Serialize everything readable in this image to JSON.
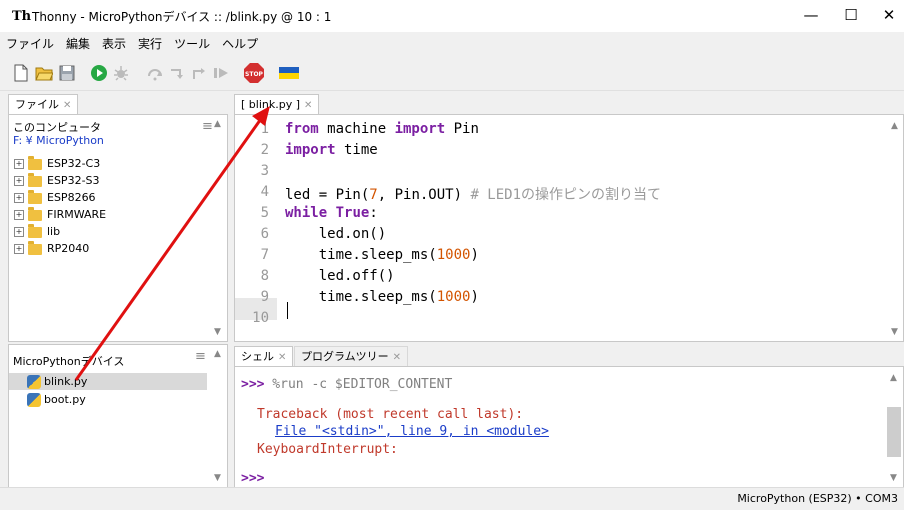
{
  "window": {
    "logo": "Th",
    "title": "Thonny  -  MicroPythonデバイス :: /blink.py  @  10 : 1",
    "minimize": "—",
    "maximize": "☐",
    "close": "✕"
  },
  "menu": [
    "ファイル",
    "編集",
    "表示",
    "実行",
    "ツール",
    "ヘルプ"
  ],
  "toolbar": [
    "new-file",
    "open-file",
    "save-file",
    "run",
    "debug",
    "step-over",
    "step-into",
    "step-out",
    "resume",
    "stop",
    "ukraine-flag"
  ],
  "stop_label": "STOP",
  "files_panel": {
    "tab_label": "ファイル",
    "computer": {
      "title": "このコンピュータ",
      "path": "F: ¥ MicroPython",
      "folders": [
        "ESP32-C3",
        "ESP32-S3",
        "ESP8266",
        "FIRMWARE",
        "lib",
        "RP2040"
      ]
    },
    "device": {
      "title": "MicroPythonデバイス",
      "files": [
        "blink.py",
        "boot.py"
      ]
    }
  },
  "editor": {
    "tab_label": "[ blink.py ]",
    "lines": [
      {
        "n": "1",
        "parts": [
          {
            "t": "from",
            "c": "kw"
          },
          {
            "t": " machine ",
            "c": ""
          },
          {
            "t": "import",
            "c": "kw"
          },
          {
            "t": " Pin",
            "c": ""
          }
        ]
      },
      {
        "n": "2",
        "parts": [
          {
            "t": "import",
            "c": "kw"
          },
          {
            "t": " time",
            "c": ""
          }
        ]
      },
      {
        "n": "3",
        "parts": []
      },
      {
        "n": "4",
        "parts": [
          {
            "t": "led = Pin(",
            "c": ""
          },
          {
            "t": "7",
            "c": "num"
          },
          {
            "t": ", Pin.OUT) ",
            "c": ""
          },
          {
            "t": "# LED1の操作ピンの割り当て",
            "c": "cm"
          }
        ]
      },
      {
        "n": "5",
        "parts": [
          {
            "t": "while",
            "c": "kw"
          },
          {
            "t": " ",
            "c": ""
          },
          {
            "t": "True",
            "c": "kw"
          },
          {
            "t": ":",
            "c": ""
          }
        ]
      },
      {
        "n": "6",
        "parts": [
          {
            "t": "    led.on()",
            "c": ""
          }
        ]
      },
      {
        "n": "7",
        "parts": [
          {
            "t": "    time.sleep_ms(",
            "c": ""
          },
          {
            "t": "1000",
            "c": "num"
          },
          {
            "t": ")",
            "c": ""
          }
        ]
      },
      {
        "n": "8",
        "parts": [
          {
            "t": "    led.off()",
            "c": ""
          }
        ]
      },
      {
        "n": "9",
        "parts": [
          {
            "t": "    time.sleep_ms(",
            "c": ""
          },
          {
            "t": "1000",
            "c": "num"
          },
          {
            "t": ")",
            "c": ""
          }
        ]
      },
      {
        "n": "10",
        "parts": []
      }
    ]
  },
  "shell": {
    "tabs": [
      "シェル",
      "プログラムツリー"
    ],
    "prompt": ">>>",
    "command": " %run -c $EDITOR_CONTENT",
    "traceback": "Traceback (most recent call last):",
    "file_link": "File \"<stdin>\", line 9, in <module>",
    "error": "KeyboardInterrupt:",
    "prompt2": ">>>"
  },
  "status": "MicroPython (ESP32)  •  COM3",
  "colors": {
    "keyword": "#7b1fa2",
    "number": "#d35400",
    "comment": "#9a9a9a",
    "prompt": "#7b1fa2",
    "error": "#c0392b",
    "link": "#1a3cc8",
    "arrow": "#e01010"
  }
}
